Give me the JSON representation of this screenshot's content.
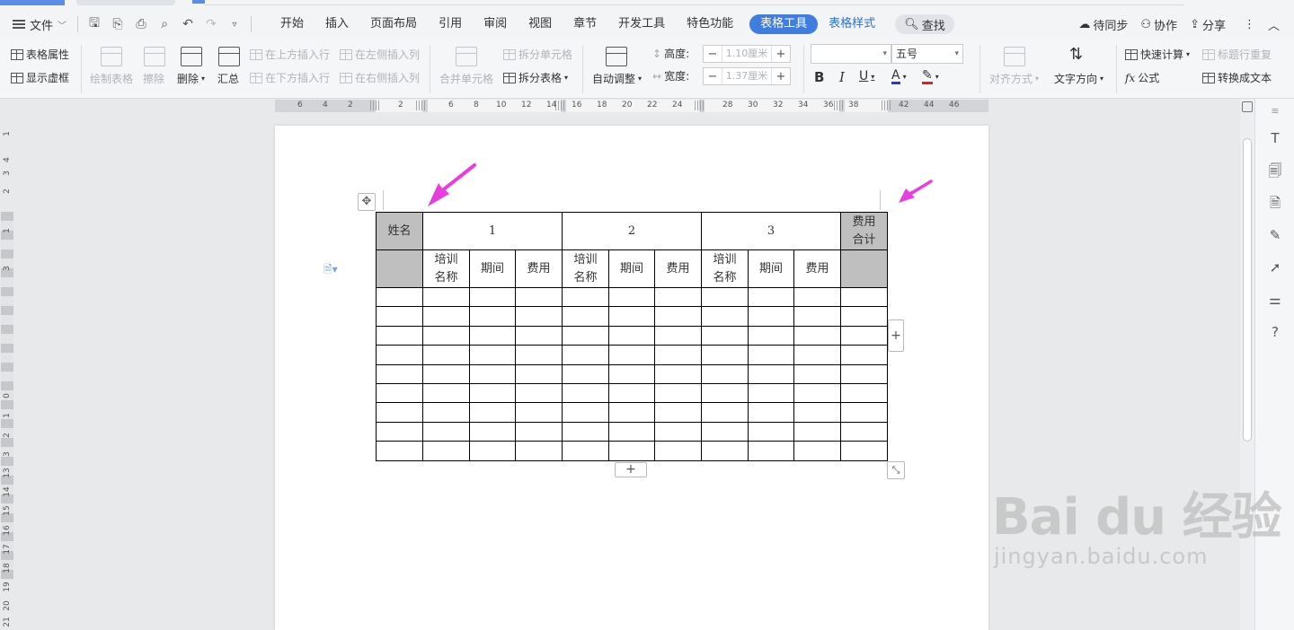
{
  "menubar": {
    "file_label": "文件",
    "tabs": [
      {
        "label": "开始",
        "state": "normal"
      },
      {
        "label": "插入",
        "state": "normal"
      },
      {
        "label": "页面布局",
        "state": "normal"
      },
      {
        "label": "引用",
        "state": "normal"
      },
      {
        "label": "审阅",
        "state": "normal"
      },
      {
        "label": "视图",
        "state": "normal"
      },
      {
        "label": "章节",
        "state": "normal"
      },
      {
        "label": "开发工具",
        "state": "normal"
      },
      {
        "label": "特色功能",
        "state": "normal"
      },
      {
        "label": "表格工具",
        "state": "active"
      },
      {
        "label": "表格样式",
        "state": "blue"
      }
    ],
    "search_label": "查找",
    "sync_label": "待同步",
    "collab_label": "协作",
    "share_label": "分享"
  },
  "ribbon": {
    "table_props": "表格属性",
    "show_gridlines": "显示虚框",
    "draw_table": "绘制表格",
    "eraser": "擦除",
    "delete": "删除",
    "summary": "汇总",
    "insert_row_above": "在上方插入行",
    "insert_row_below": "在下方插入行",
    "insert_col_left": "在左侧插入列",
    "insert_col_right": "在右侧插入列",
    "merge_cells": "合并单元格",
    "split_cells": "拆分单元格",
    "split_table": "拆分表格",
    "autofit": "自动调整",
    "height_label": "高度:",
    "height_value": "1.10厘米",
    "width_label": "宽度:",
    "width_value": "1.37厘米",
    "font_name": "",
    "font_size": "五号",
    "align": "对齐方式",
    "text_direction": "文字方向",
    "quick_calc": "快速计算",
    "header_repeat": "标题行重复",
    "formula": "公式",
    "convert_text": "转换成文本",
    "font_color": "#1f3fbf",
    "highlight_color": "#e02020"
  },
  "ruler": {
    "h_ticks": [
      "6",
      "4",
      "2",
      "2",
      "6",
      "8",
      "10",
      "12",
      "14",
      "16",
      "18",
      "20",
      "22",
      "24",
      "28",
      "30",
      "32",
      "34",
      "36",
      "38",
      "42",
      "44",
      "46"
    ],
    "v_ticks": [
      "1",
      "2",
      "3",
      "4",
      "1",
      "3",
      "0",
      "1",
      "2",
      "3",
      "13",
      "14",
      "15",
      "16",
      "17",
      "18",
      "19",
      "20",
      "21",
      "22"
    ]
  },
  "table": {
    "row1": {
      "name": "姓名",
      "g1": "1",
      "g2": "2",
      "g3": "3",
      "total": "费用合计"
    },
    "row2": {
      "c1": "培训名称",
      "c2": "期间",
      "c3": "费用",
      "c4": "培训名称",
      "c5": "期间",
      "c6": "费用",
      "c7": "培训名称",
      "c8": "期间",
      "c9": "费用"
    },
    "empty_rows": 9
  },
  "annotations": {
    "arrow_color": "#e83ee0"
  },
  "watermark": {
    "main": "Bai du 经验",
    "sub": "jingyan.baidu.com"
  }
}
